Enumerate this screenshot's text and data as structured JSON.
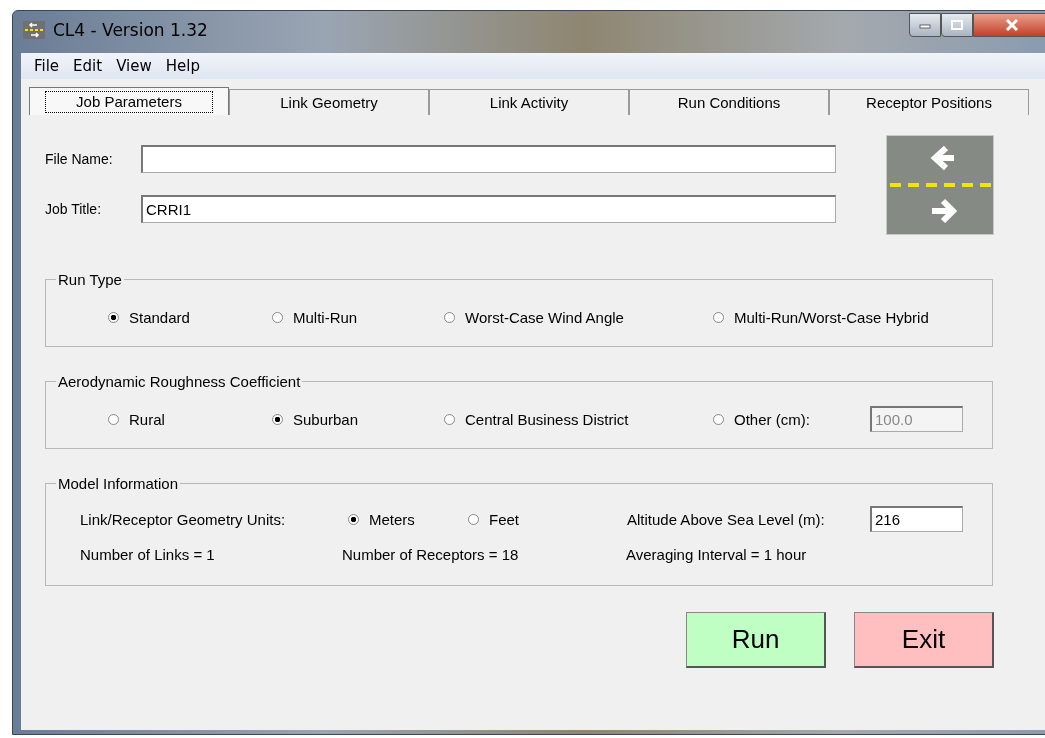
{
  "window": {
    "title": "CL4 - Version 1.32"
  },
  "menu": [
    "File",
    "Edit",
    "View",
    "Help"
  ],
  "tabs": [
    {
      "label": "Job Parameters",
      "selected": true
    },
    {
      "label": "Link Geometry",
      "selected": false
    },
    {
      "label": "Link Activity",
      "selected": false
    },
    {
      "label": "Run Conditions",
      "selected": false
    },
    {
      "label": "Receptor Positions",
      "selected": false
    }
  ],
  "fields": [
    {
      "label": "File Name:"
    },
    {
      "label": "Job Title:",
      "value": "CRRI1"
    }
  ],
  "run_type": {
    "title": "Run Type",
    "options": [
      {
        "label": "Standard",
        "selected": true
      },
      {
        "label": "Multi-Run",
        "selected": false
      },
      {
        "label": "Worst-Case Wind Angle",
        "selected": false
      },
      {
        "label": "Multi-Run/Worst-Case Hybrid",
        "selected": false
      }
    ]
  },
  "roughness": {
    "title": "Aerodynamic Roughness Coefficient",
    "options": [
      {
        "label": "Rural",
        "selected": false
      },
      {
        "label": "Suburban",
        "selected": true
      },
      {
        "label": "Central Business District",
        "selected": false
      },
      {
        "label": "Other (cm):",
        "selected": false
      }
    ],
    "other_value": "100.0",
    "other_disabled": true
  },
  "model": {
    "title": "Model Information",
    "units_label": "Link/Receptor Geometry Units:",
    "units": [
      {
        "label": "Meters",
        "selected": true
      },
      {
        "label": "Feet",
        "selected": false
      }
    ],
    "altitude_label": "Altitude Above Sea Level (m):",
    "altitude": "216",
    "stats": [
      "Number of Links = 1",
      "Number of Receptors = 18",
      "Averaging Interval = 1 hour"
    ]
  },
  "buttons": [
    {
      "label": "Run",
      "kind": "run"
    },
    {
      "label": "Exit",
      "kind": "exit"
    }
  ]
}
